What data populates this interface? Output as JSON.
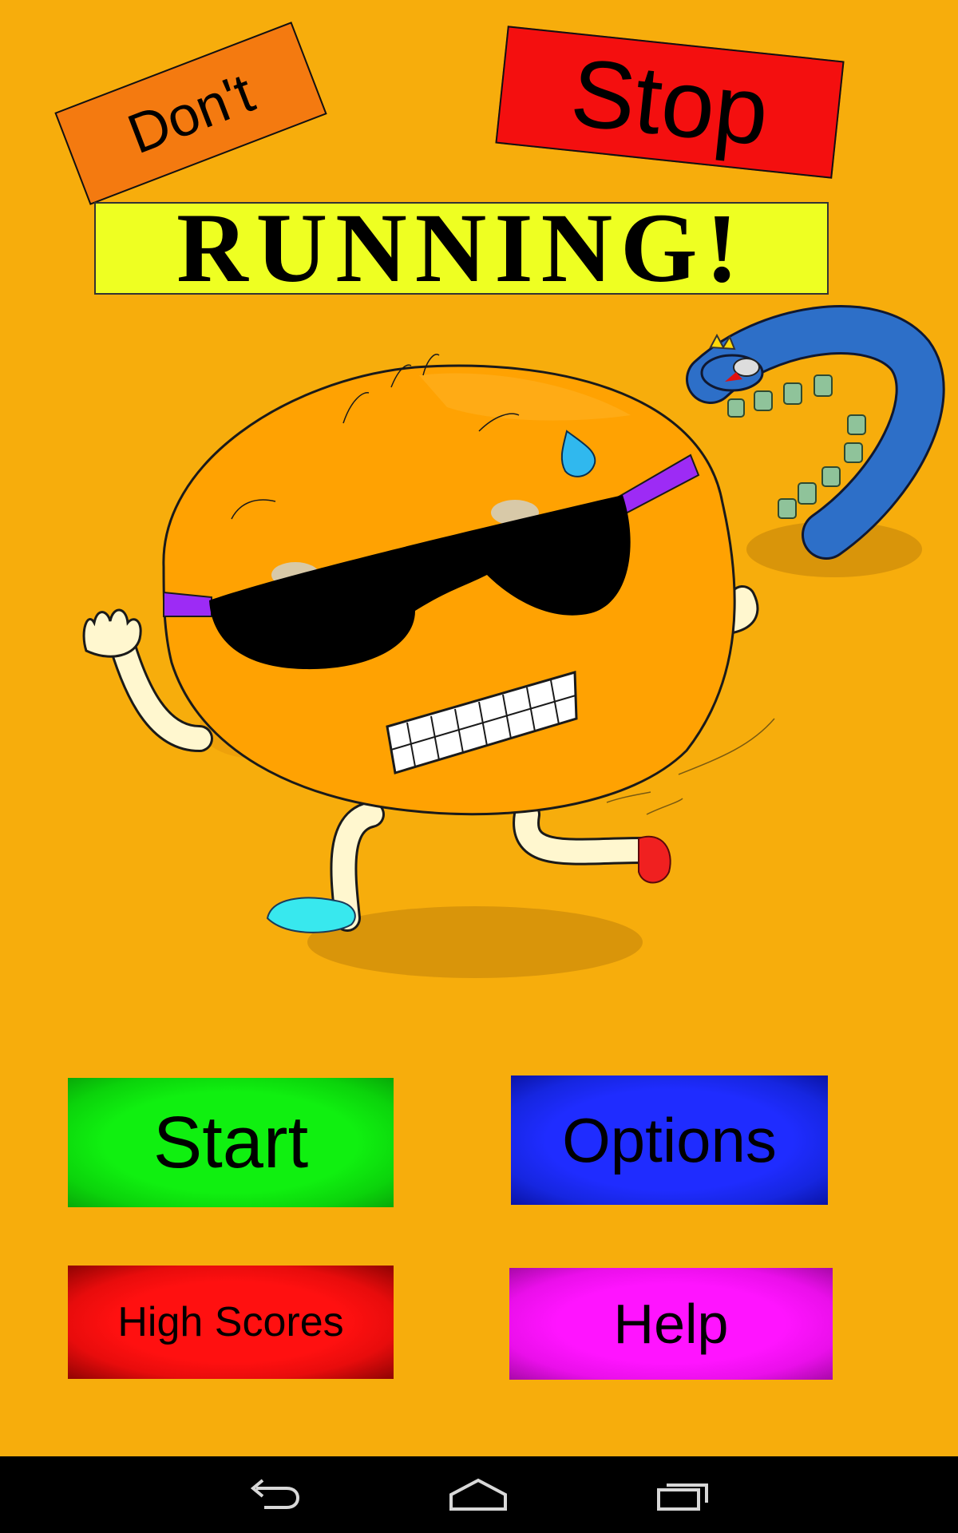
{
  "title": {
    "dont": "Don't",
    "stop": "Stop",
    "running": "RUNNING!"
  },
  "menu": {
    "start": "Start",
    "options": "Options",
    "high_scores": "High Scores",
    "help": "Help"
  },
  "colors": {
    "background": "#f7ad0c",
    "dont_sign": "#f47a10",
    "stop_sign": "#f40f0f",
    "running_banner": "#eeff22",
    "start_button": "#10f010",
    "options_button": "#1f2cff",
    "high_scores_button": "#ff1010",
    "help_button": "#ff14ff"
  },
  "nav_icons": [
    "back-icon",
    "home-icon",
    "recents-icon"
  ]
}
